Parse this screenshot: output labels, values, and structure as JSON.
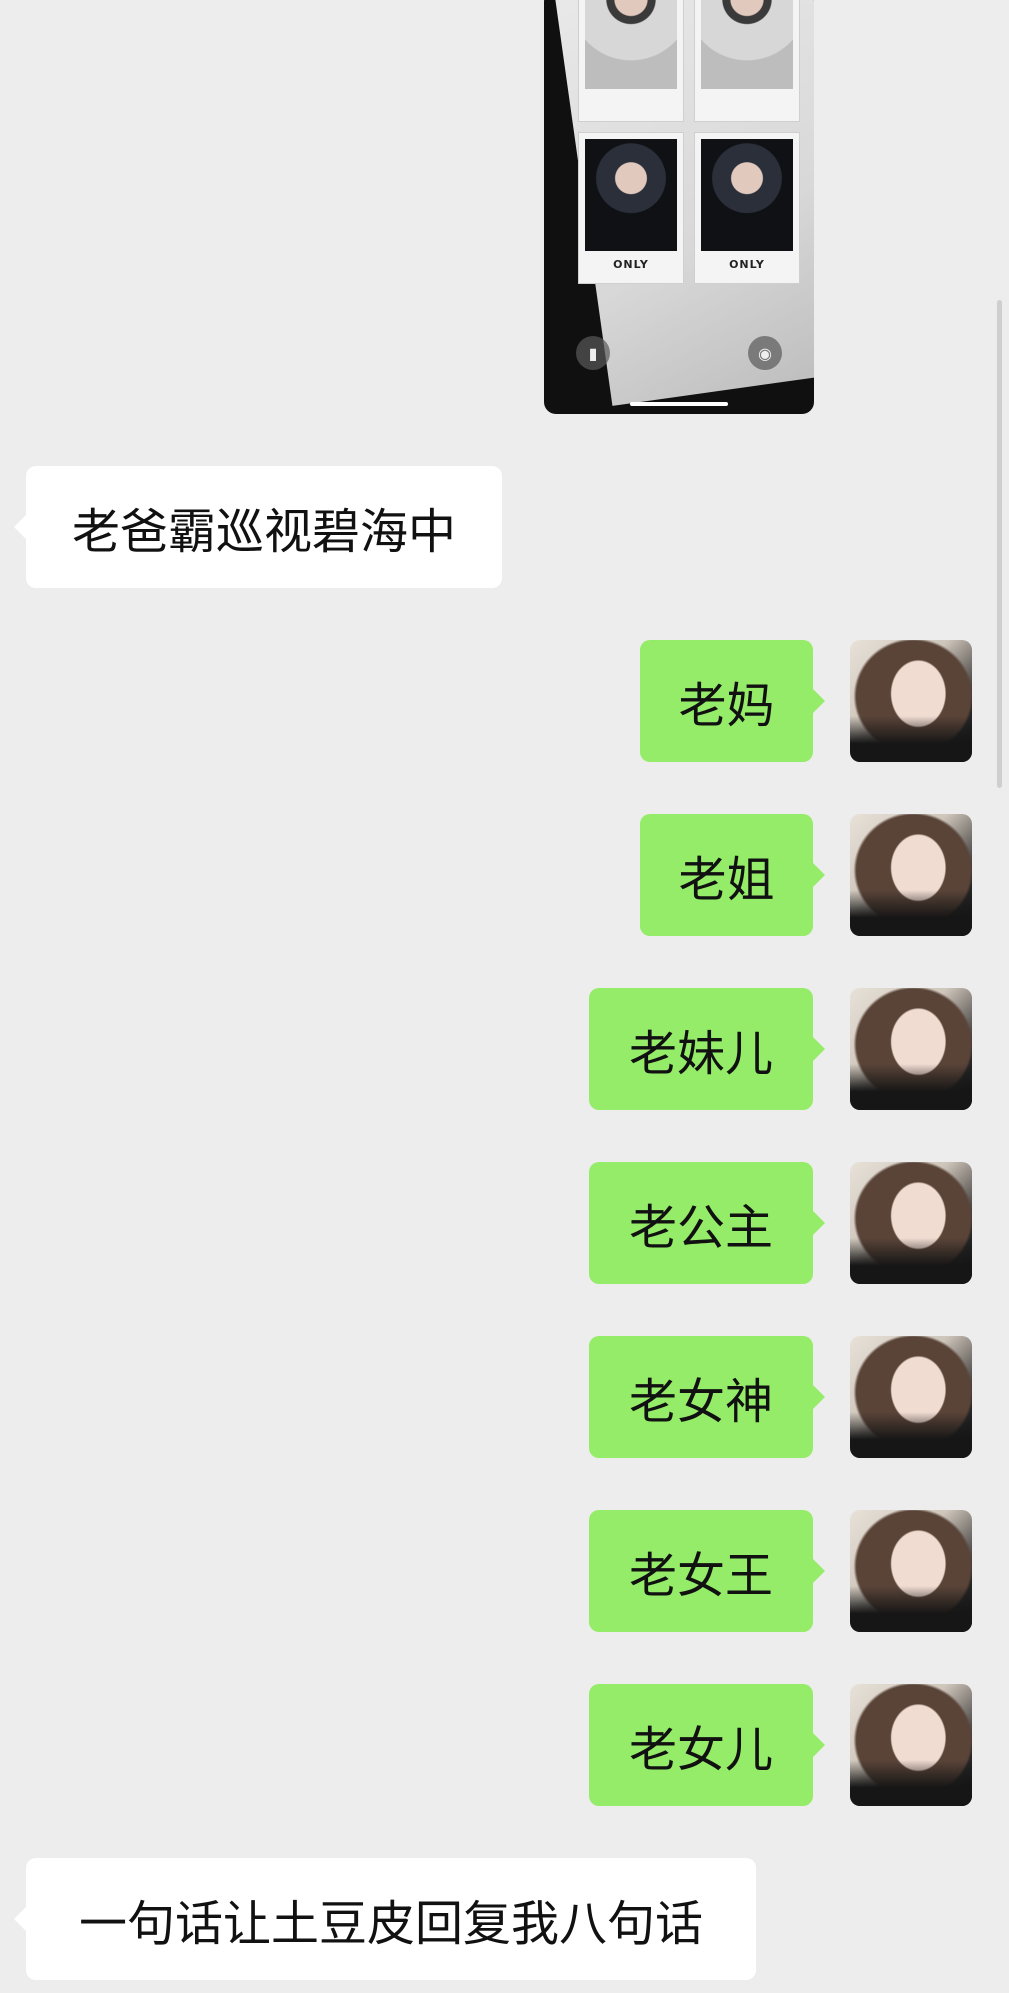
{
  "chat": {
    "image_message": {
      "poster_caption_left": "ONLY",
      "poster_caption_right": "ONLY",
      "left_icon": "flashlight-icon",
      "right_icon": "camera-icon"
    },
    "messages": [
      {
        "side": "in",
        "text": "老爸霸巡视碧海中"
      },
      {
        "side": "out",
        "text": "老妈"
      },
      {
        "side": "out",
        "text": "老姐"
      },
      {
        "side": "out",
        "text": "老妹儿"
      },
      {
        "side": "out",
        "text": "老公主"
      },
      {
        "side": "out",
        "text": "老女神"
      },
      {
        "side": "out",
        "text": "老女王"
      },
      {
        "side": "out",
        "text": "老女儿"
      },
      {
        "side": "in",
        "text": "一句话让土豆皮回复我八句话"
      }
    ]
  },
  "colors": {
    "background": "#ededed",
    "incoming_bubble": "#ffffff",
    "outgoing_bubble": "#95ec69",
    "text": "#111111"
  }
}
